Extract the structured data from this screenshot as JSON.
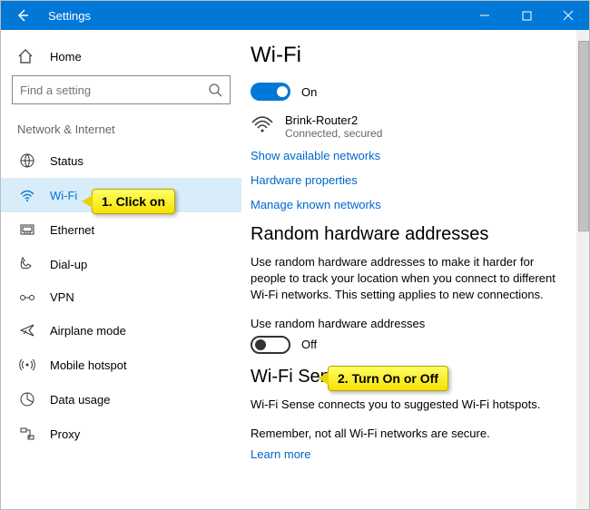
{
  "titlebar": {
    "title": "Settings"
  },
  "sidebar": {
    "home": "Home",
    "search_placeholder": "Find a setting",
    "section": "Network & Internet",
    "items": [
      {
        "label": "Status"
      },
      {
        "label": "Wi-Fi"
      },
      {
        "label": "Ethernet"
      },
      {
        "label": "Dial-up"
      },
      {
        "label": "VPN"
      },
      {
        "label": "Airplane mode"
      },
      {
        "label": "Mobile hotspot"
      },
      {
        "label": "Data usage"
      },
      {
        "label": "Proxy"
      }
    ]
  },
  "main": {
    "title": "Wi-Fi",
    "wifi_toggle_state": "On",
    "network": {
      "name": "Brink-Router2",
      "status": "Connected, secured"
    },
    "links": {
      "show_networks": "Show available networks",
      "hw_props": "Hardware properties",
      "manage_known": "Manage known networks"
    },
    "random_title": "Random hardware addresses",
    "random_desc": "Use random hardware addresses to make it harder for people to track your location when you connect to different Wi-Fi networks. This setting applies to new connections.",
    "random_label": "Use random hardware addresses",
    "random_state": "Off",
    "sense_title": "Wi-Fi Sense",
    "sense_desc1": "Wi-Fi Sense connects you to suggested Wi-Fi hotspots.",
    "sense_desc2": "Remember, not all Wi-Fi networks are secure.",
    "sense_learn": "Learn more"
  },
  "callouts": {
    "c1": "1. Click on",
    "c2": "2. Turn On or Off"
  }
}
